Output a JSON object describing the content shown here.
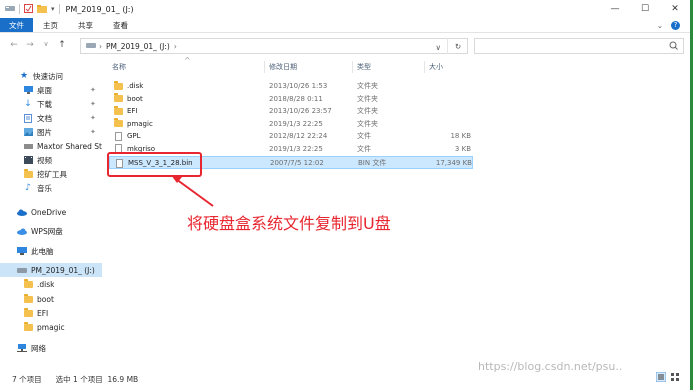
{
  "window": {
    "title": "PM_2019_01_ (J:)",
    "minimize": "—",
    "maximize": "☐",
    "close": "✕"
  },
  "ribbon": {
    "tabs": [
      "文件",
      "主页",
      "共享",
      "查看"
    ],
    "expand": "⌄",
    "help": "?"
  },
  "address": {
    "crumb": "PM_2019_01_ (J:)",
    "refresh": "↻",
    "search_icon": "search-icon"
  },
  "nav": {
    "items": [
      {
        "label": "快速访问",
        "icon": "star-icon",
        "pinned": false
      },
      {
        "label": "桌面",
        "icon": "desktop-icon",
        "pinned": true
      },
      {
        "label": "下载",
        "icon": "download-icon",
        "pinned": true
      },
      {
        "label": "文档",
        "icon": "document-icon",
        "pinned": true
      },
      {
        "label": "图片",
        "icon": "picture-icon",
        "pinned": true
      },
      {
        "label": "Maxtor Shared Storage",
        "icon": "drive-icon",
        "pinned": false
      },
      {
        "label": "视频",
        "icon": "video-icon",
        "pinned": false
      },
      {
        "label": "挖矿工具",
        "icon": "folder-icon",
        "pinned": false
      },
      {
        "label": "音乐",
        "icon": "music-icon",
        "pinned": false
      },
      {
        "label": "OneDrive",
        "icon": "cloud-icon",
        "pinned": false
      },
      {
        "label": "WPS网盘",
        "icon": "cloud-icon",
        "pinned": false
      },
      {
        "label": "此电脑",
        "icon": "computer-icon",
        "pinned": false
      },
      {
        "label": "PM_2019_01_ (J:)",
        "icon": "drive-icon",
        "pinned": false
      },
      {
        "label": ".disk",
        "icon": "folder-icon",
        "pinned": false
      },
      {
        "label": "boot",
        "icon": "folder-icon",
        "pinned": false
      },
      {
        "label": "EFI",
        "icon": "folder-icon",
        "pinned": false
      },
      {
        "label": "pmagic",
        "icon": "folder-icon",
        "pinned": false
      },
      {
        "label": "网络",
        "icon": "network-icon",
        "pinned": false
      }
    ],
    "pin_glyph": "✦"
  },
  "columns": {
    "name": "名称",
    "date": "修改日期",
    "type": "类型",
    "size": "大小"
  },
  "files": [
    {
      "name": ".disk",
      "date": "2013/10/26 1:53",
      "type": "文件夹",
      "size": "",
      "kind": "folder"
    },
    {
      "name": "boot",
      "date": "2018/8/28 0:11",
      "type": "文件夹",
      "size": "",
      "kind": "folder"
    },
    {
      "name": "EFI",
      "date": "2013/10/26 23:57",
      "type": "文件夹",
      "size": "",
      "kind": "folder"
    },
    {
      "name": "pmagic",
      "date": "2019/1/3 22:25",
      "type": "文件夹",
      "size": "",
      "kind": "folder"
    },
    {
      "name": "GPL",
      "date": "2012/8/12 22:24",
      "type": "文件",
      "size": "18 KB",
      "kind": "file"
    },
    {
      "name": "mkgriso",
      "date": "2019/1/3 22:25",
      "type": "文件",
      "size": "3 KB",
      "kind": "file"
    },
    {
      "name": "MSS_V_3_1_28.bin",
      "date": "2007/7/5 12:02",
      "type": "BIN 文件",
      "size": "17,349 KB",
      "kind": "file"
    }
  ],
  "annotation": {
    "text": "将硬盘盒系统文件复制到U盘",
    "color": "#e8262f"
  },
  "status": {
    "count": "7 个项目",
    "selected": "选中 1 个项目",
    "size": "16.9 MB"
  },
  "watermark": "https://blog.csdn.net/psu..",
  "colors": {
    "accent": "#1a6fc9",
    "selection": "#cce8ff",
    "annotation": "#e8262f"
  }
}
